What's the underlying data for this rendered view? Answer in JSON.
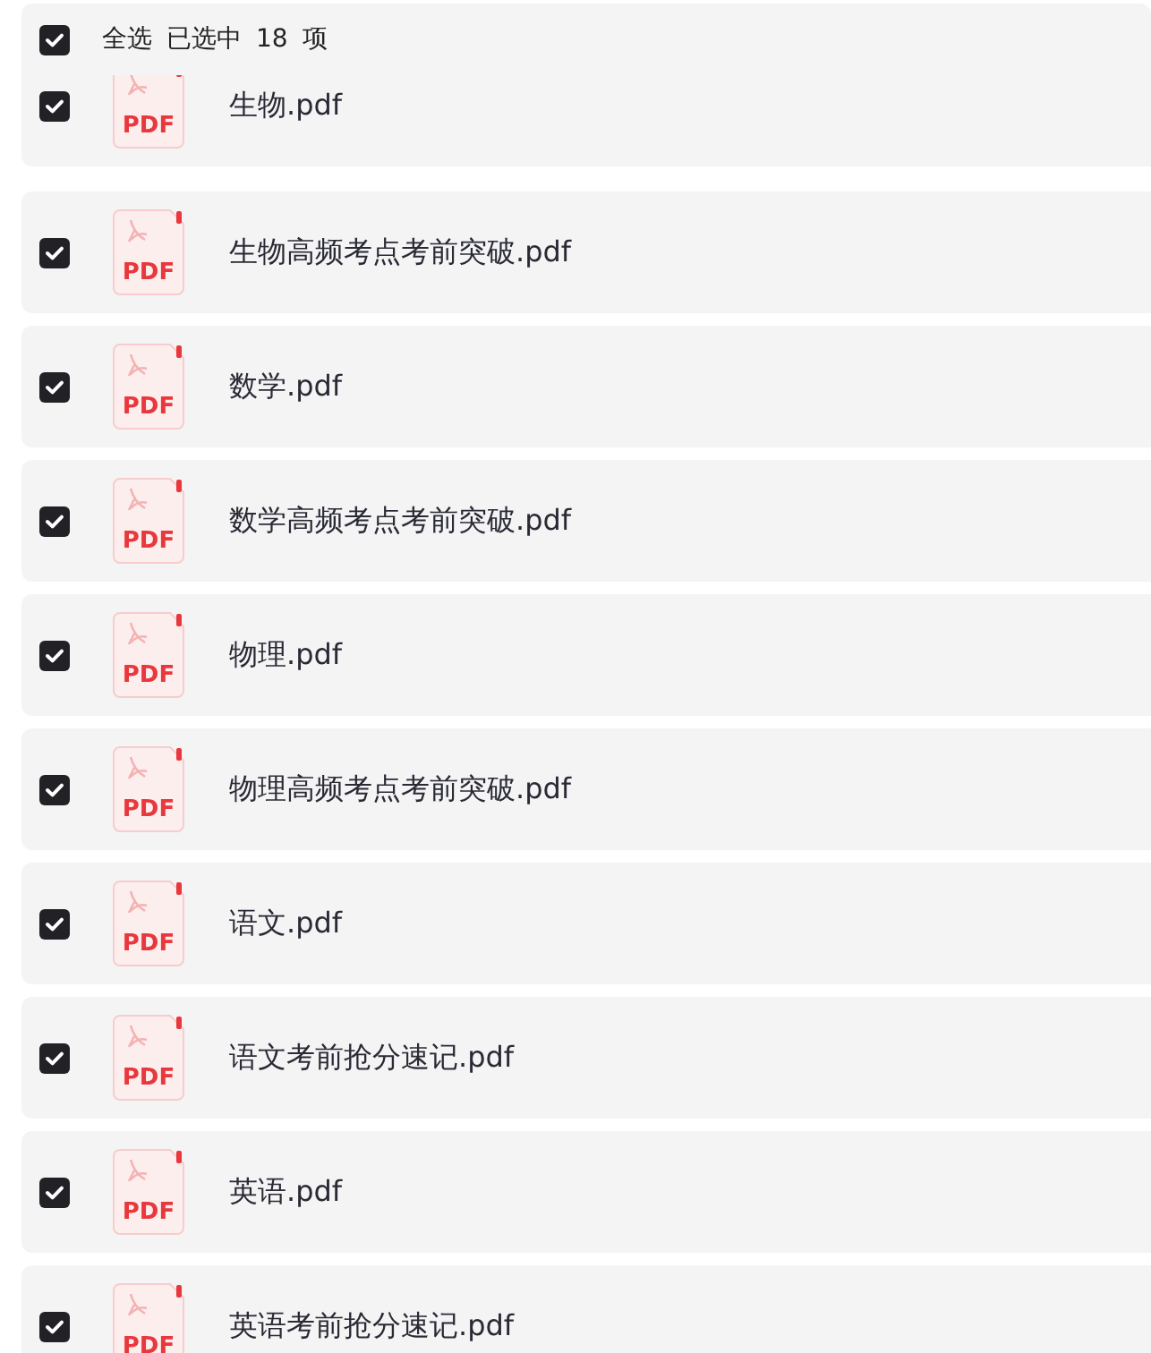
{
  "header": {
    "select_all_checked": true,
    "select_all_label": "全选",
    "selected_prefix": "已选中",
    "selected_count": "18",
    "selected_suffix": "项"
  },
  "files": [
    {
      "name": "生物.pdf",
      "type_label": "PDF",
      "checked": true
    },
    {
      "name": "生物高频考点考前突破.pdf",
      "type_label": "PDF",
      "checked": true
    },
    {
      "name": "数学.pdf",
      "type_label": "PDF",
      "checked": true
    },
    {
      "name": "数学高频考点考前突破.pdf",
      "type_label": "PDF",
      "checked": true
    },
    {
      "name": "物理.pdf",
      "type_label": "PDF",
      "checked": true
    },
    {
      "name": "物理高频考点考前突破.pdf",
      "type_label": "PDF",
      "checked": true
    },
    {
      "name": "语文.pdf",
      "type_label": "PDF",
      "checked": true
    },
    {
      "name": "语文考前抢分速记.pdf",
      "type_label": "PDF",
      "checked": true
    },
    {
      "name": "英语.pdf",
      "type_label": "PDF",
      "checked": true
    },
    {
      "name": "英语考前抢分速记.pdf",
      "type_label": "PDF",
      "checked": true
    }
  ]
}
